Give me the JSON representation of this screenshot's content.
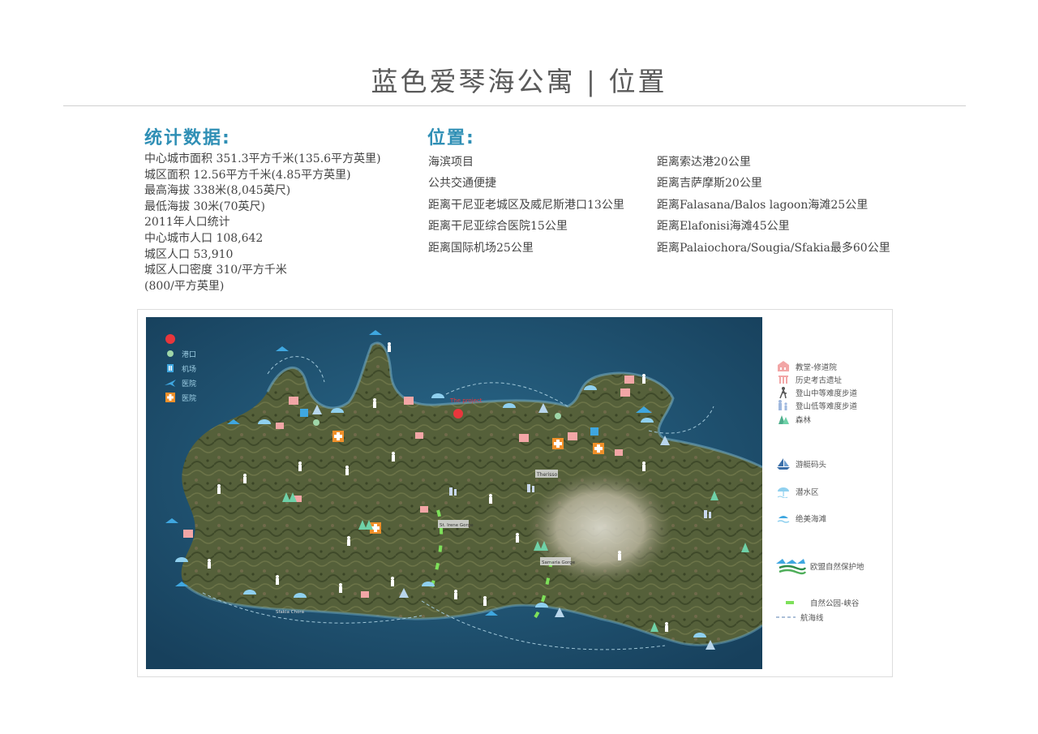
{
  "title": "蓝色爱琴海公寓 | 位置",
  "stats": {
    "heading": "统计数据:",
    "lines": [
      "中心城市面积 351.3平方千米(135.6平方英里)",
      "城区面积 12.56平方千米(4.85平方英里)",
      "最高海拔 338米(8,045英尺)",
      "最低海拔 30米(70英尺)",
      "2011年人口统计",
      "中心城市人口 108,642",
      "城区人口 53,910",
      "城区人口密度 310/平方千米",
      "(800/平方英里)"
    ]
  },
  "location": {
    "heading": "位置:",
    "left": [
      "海滨项目",
      "公共交通便捷",
      "距离干尼亚老城区及威尼斯港口13公里",
      "距离干尼亚综合医院15公里",
      "距离国际机场25公里"
    ],
    "right": [
      "距离索达港20公里",
      "距离吉萨摩斯20公里",
      "距离Falasana/Balos lagoon海滩25公里",
      "距离Elafonisi海滩45公里",
      "距离Palaiochora/Sougia/Sfakia最多60公里"
    ]
  },
  "map_legend": {
    "items": [
      {
        "label": "",
        "icon": "red-dot-icon",
        "color": "#e8363c"
      },
      {
        "label": "港口",
        "icon": "port-dot-icon",
        "color": "#9fd6a8"
      },
      {
        "label": "机场",
        "icon": "airport-icon",
        "color": "#3fa7e0"
      },
      {
        "label": "医院",
        "icon": "plane-icon",
        "color": "#3fa7e0"
      },
      {
        "label": "医院",
        "icon": "hospital-cross-icon",
        "color": "#f0902a"
      }
    ]
  },
  "legend": {
    "items": [
      {
        "label": "教堂-修道院",
        "icon": "church-icon"
      },
      {
        "label": "历史考古遗址",
        "icon": "ruins-icon"
      },
      {
        "label": "登山中等难度步道",
        "icon": "hiker-icon"
      },
      {
        "label": "登山低等难度步道",
        "icon": "family-hike-icon"
      },
      {
        "label": "森林",
        "icon": "forest-icon"
      },
      {
        "label": "游艇码头",
        "icon": "yacht-icon"
      },
      {
        "label": "潜水区",
        "icon": "diving-icon"
      },
      {
        "label": "绝美海滩",
        "icon": "beach-icon"
      },
      {
        "label": "欧盟自然保护地",
        "icon": "nature-reserve-icon"
      },
      {
        "label": "自然公园-峡谷",
        "icon": "gorge-icon"
      },
      {
        "label": "航海线",
        "icon": "sea-route-icon"
      }
    ]
  },
  "map_labels": {
    "project": "The project",
    "town": "Therisso",
    "gorge1": "St. Irene Gorge",
    "gorge2": "Samaria Gorge",
    "south": "Sfakia Chora"
  },
  "colors": {
    "accent": "#2f8fb5",
    "sea": "#1f4c6a",
    "land": "#4f5a36",
    "hospital": "#f0902a",
    "project": "#e8363c"
  }
}
